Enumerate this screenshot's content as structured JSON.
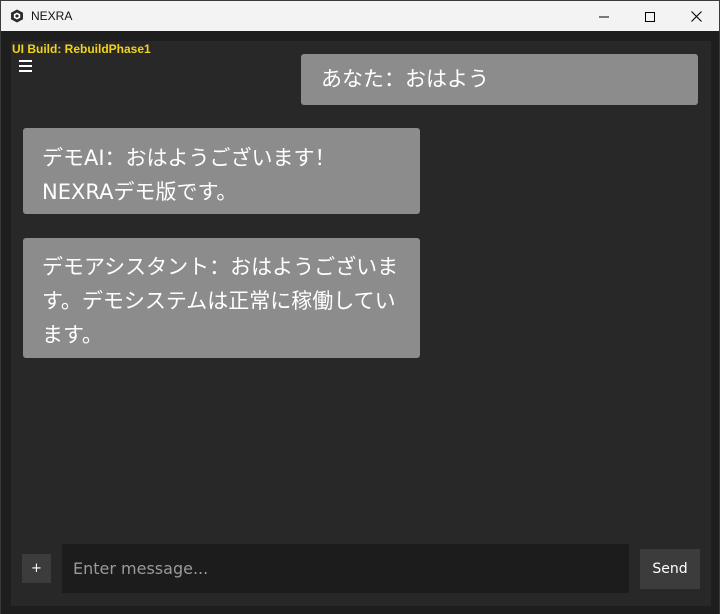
{
  "window": {
    "title": "NEXRA",
    "app_icon": "nexra-logo-icon",
    "controls": {
      "minimize_icon": "minimize-icon",
      "maximize_icon": "maximize-icon",
      "close_icon": "close-icon"
    }
  },
  "header": {
    "build_label": "UI Build: RebuildPhase1",
    "build_label_color": "#f2d31a",
    "menu_icon": "hamburger-menu-icon"
  },
  "messages": [
    {
      "role": "user",
      "text": "あなた：おはよう"
    },
    {
      "role": "assistant",
      "text": "デモAI：おはようございます！\nNEXRAデモ版です。"
    },
    {
      "role": "assistant",
      "text": "デモアシスタント：おはようございます。デモシステムは正常に稼働しています。"
    }
  ],
  "composer": {
    "attach_label": "+",
    "input_value": "",
    "input_placeholder": "Enter message...",
    "send_label": "Send"
  },
  "colors": {
    "bubble": "#8c8c8c",
    "panel": "#282828",
    "input": "#1c1c1c",
    "button": "#3c3c3c"
  }
}
